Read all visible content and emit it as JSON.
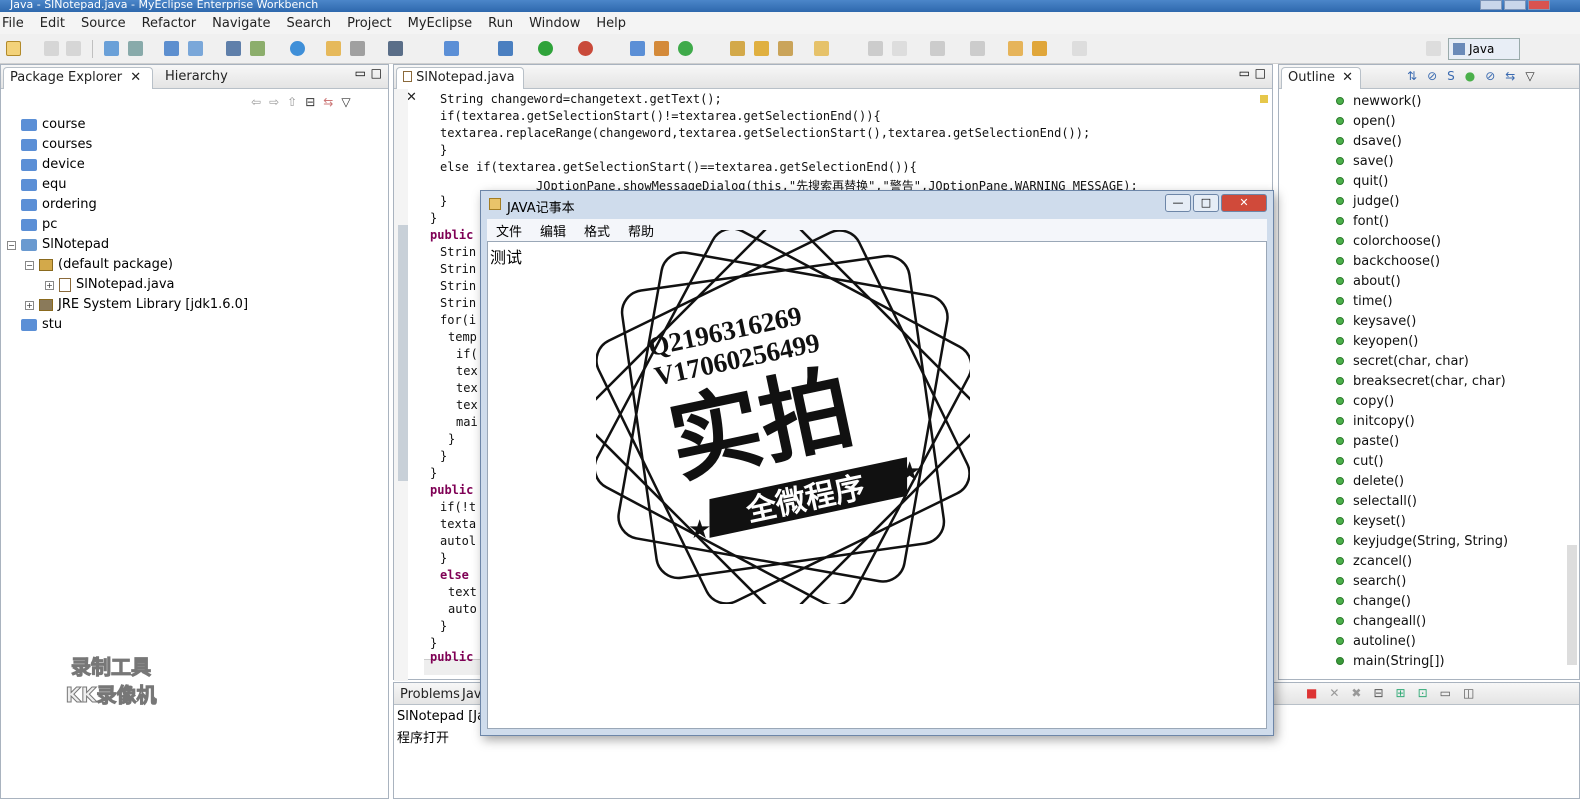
{
  "window": {
    "title": "Java - SlNotepad.java - MyEclipse Enterprise Workbench"
  },
  "menu": [
    "File",
    "Edit",
    "Source",
    "Refactor",
    "Navigate",
    "Search",
    "Project",
    "MyEclipse",
    "Run",
    "Window",
    "Help"
  ],
  "perspective": "Java",
  "explorer": {
    "tabs": [
      "Package Explorer",
      "Hierarchy"
    ],
    "items": [
      "course",
      "courses",
      "device",
      "equ",
      "ordering",
      "pc",
      "SlNotepad",
      "(default package)",
      "SlNotepad.java",
      "JRE System Library [jdk1.6.0]",
      "stu"
    ]
  },
  "editor": {
    "tab": "SlNotepad.java",
    "lines": [
      "String changeword=changetext.getText();",
      "if(textarea.getSelectionStart()!=textarea.getSelectionEnd()){",
      "textarea.replaceRange(changeword,textarea.getSelectionStart(),textarea.getSelectionEnd());",
      "}",
      "else if(textarea.getSelectionStart()==textarea.getSelectionEnd()){",
      "JOptionPane.showMessageDialog(this,\"先搜索再替换\",\"警告\",JOptionPane.WARNING_MESSAGE);",
      "}",
      "}",
      "public",
      "Strin",
      "Strin",
      "Strin",
      "Strin",
      "for(i",
      "temp",
      "if(",
      "tex",
      "tex",
      "tex",
      "mai",
      "}",
      "}",
      "}",
      "public",
      "if(!t",
      "texta",
      "autol",
      "}",
      "else",
      "text",
      "auto",
      "}",
      "}",
      "public"
    ]
  },
  "outline": {
    "tab": "Outline",
    "items": [
      "newwork()",
      "open()",
      "dsave()",
      "save()",
      "quit()",
      "judge()",
      "font()",
      "colorchoose()",
      "backchoose()",
      "about()",
      "time()",
      "keysave()",
      "keyopen()",
      "secret(char, char)",
      "breaksecret(char, char)",
      "copy()",
      "initcopy()",
      "paste()",
      "cut()",
      "delete()",
      "selectall()",
      "keyset()",
      "keyjudge(String, String)",
      "zcancel()",
      "search()",
      "change()",
      "changeall()",
      "autoline()",
      "main(String[])"
    ]
  },
  "console": {
    "tabs": [
      "Problems",
      "Jav"
    ],
    "header": "SlNotepad [Ja",
    "output": "程序打开"
  },
  "dialog": {
    "title": "JAVA记事本",
    "menu": [
      "文件",
      "编辑",
      "格式",
      "帮助"
    ],
    "content": "测试"
  },
  "stamp": {
    "line1": "Q2196316269",
    "line2": "V17060256499",
    "big": "实拍",
    "banner": "全微程序"
  },
  "watermark": {
    "line1": "录制工具",
    "line2": "KK录像机"
  }
}
